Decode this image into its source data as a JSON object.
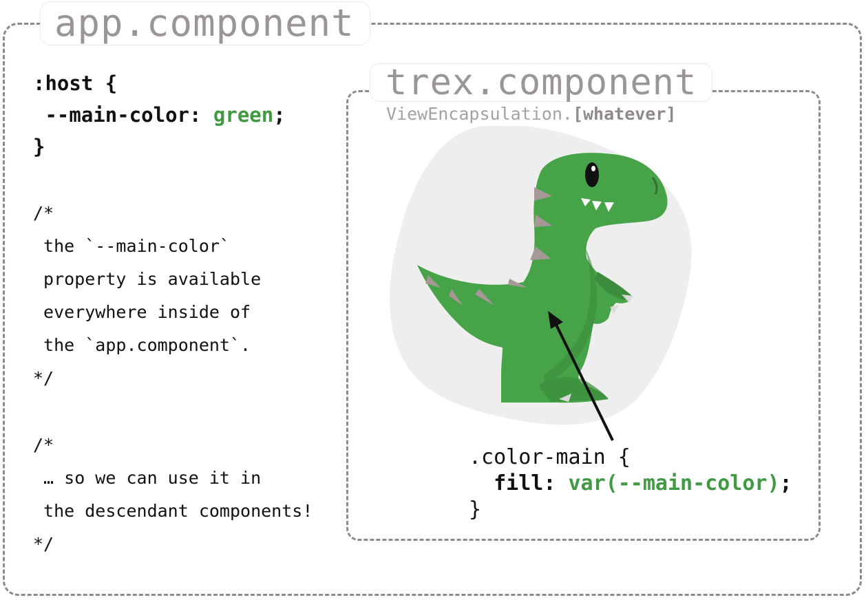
{
  "outer": {
    "title": "app.component",
    "host_code": {
      "selector": ":host {",
      "property": "--main-color:",
      "value": "green",
      "semicolon": ";",
      "close": "}"
    },
    "comment_1": {
      "open": "/*",
      "lines": [
        " the `--main-color`",
        " property is available",
        " everywhere inside of",
        " the `app.component`."
      ],
      "close": "*/"
    },
    "comment_2": {
      "open": "/*",
      "lines": [
        " … so we can use it in",
        " the descendant components!"
      ],
      "close": "*/"
    }
  },
  "inner": {
    "title": "trex.component",
    "subtitle_prefix": "ViewEncapsulation.",
    "subtitle_value": "[whatever]",
    "css_code": {
      "selector": ".color-main {",
      "property": "fill:",
      "value": "var(--main-color)",
      "semicolon": ";",
      "close": "}"
    },
    "illustration": "t-rex-icon"
  },
  "colors": {
    "main_green": "#47a348",
    "code_green": "#3f9a41",
    "border_gray": "#8f8a87",
    "blob_gray": "#eeeeee",
    "spike_gray": "#a59896"
  }
}
